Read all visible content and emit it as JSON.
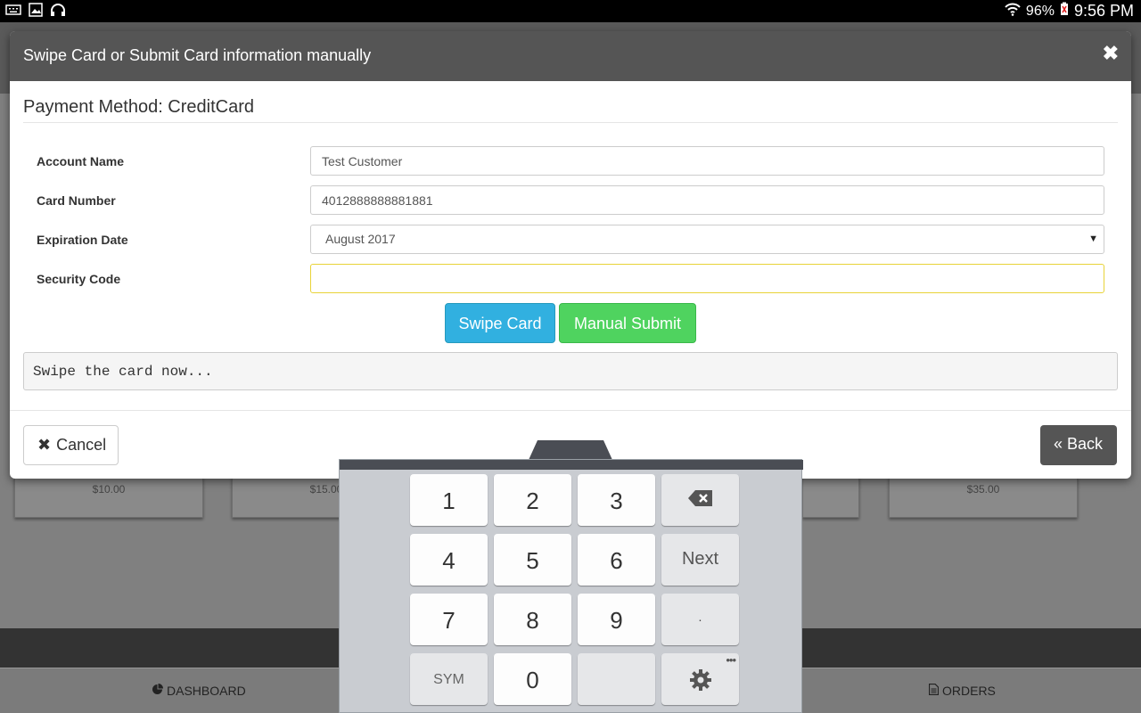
{
  "status_bar": {
    "battery": "96%",
    "time": "9:56 PM"
  },
  "background": {
    "card_prices": [
      "$10.00",
      "$15.00",
      "$35.00"
    ],
    "nav": {
      "dashboard": "DASHBOARD",
      "orders": "ORDERS"
    }
  },
  "modal": {
    "title": "Swipe Card or Submit Card information manually",
    "payment_method": "Payment Method: CreditCard",
    "fields": {
      "account_name": {
        "label": "Account Name",
        "value": "Test Customer"
      },
      "card_number": {
        "label": "Card Number",
        "value": "4012888888881881"
      },
      "expiration_date": {
        "label": "Expiration Date",
        "value": "August 2017"
      },
      "security_code": {
        "label": "Security Code",
        "value": ""
      }
    },
    "buttons": {
      "swipe": "Swipe Card",
      "manual_submit": "Manual Submit",
      "cancel": "Cancel",
      "back": "Back"
    },
    "status_message": "Swipe the card now..."
  },
  "keyboard": {
    "keys": {
      "k1": "1",
      "k2": "2",
      "k3": "3",
      "k4": "4",
      "k5": "5",
      "k6": "6",
      "k7": "7",
      "k8": "8",
      "k9": "9",
      "k0": "0",
      "next": "Next",
      "dot": ".",
      "sym": "SYM",
      "more": "•••"
    }
  },
  "colors": {
    "swipe_button": "#31b0e0",
    "manual_submit_button": "#4fd35f",
    "modal_header": "#555555",
    "focus_border": "#e8d338"
  }
}
